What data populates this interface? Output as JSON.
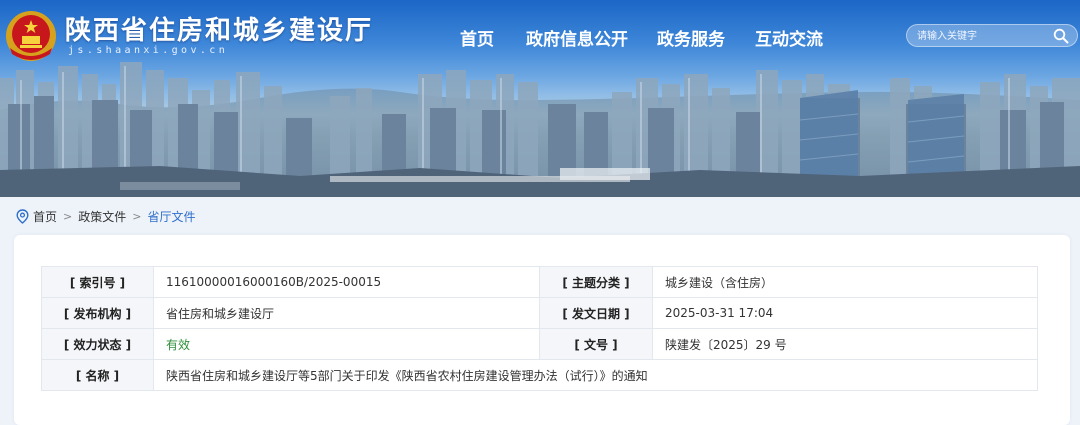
{
  "header": {
    "site_title": "陕西省住房和城乡建设厅",
    "site_domain": "js.shaanxi.gov.cn",
    "nav": [
      {
        "label": "首页"
      },
      {
        "label": "政府信息公开"
      },
      {
        "label": "政务服务"
      },
      {
        "label": "互动交流"
      }
    ],
    "search": {
      "placeholder": "请输入关键字"
    }
  },
  "breadcrumb": {
    "items": [
      "首页",
      "政策文件",
      "省厅文件"
    ],
    "separator": ">"
  },
  "document_meta": {
    "rows": [
      {
        "label1": "[ 索引号 ]",
        "value1": "11610000016000160B/2025-00015",
        "label2": "[ 主题分类 ]",
        "value2": "城乡建设（含住房）"
      },
      {
        "label1": "[ 发布机构 ]",
        "value1": "省住房和城乡建设厅",
        "label2": "[ 发文日期 ]",
        "value2": "2025-03-31 17:04"
      },
      {
        "label1": "[ 效力状态 ]",
        "value1": "有效",
        "label2": "[ 文号 ]",
        "value2": "陕建发〔2025〕29 号"
      }
    ],
    "name_label": "[ 名称 ]",
    "name_value": "陕西省住房和城乡建设厅等5部门关于印发《陕西省农村住房建设管理办法（试行）》的通知"
  },
  "colors": {
    "nav_text": "#ffffff",
    "breadcrumb_current": "#2f6fc9",
    "valid_status": "#2d8f3a",
    "page_bg": "#eef3fa",
    "label_bg": "#f4f6f9"
  }
}
